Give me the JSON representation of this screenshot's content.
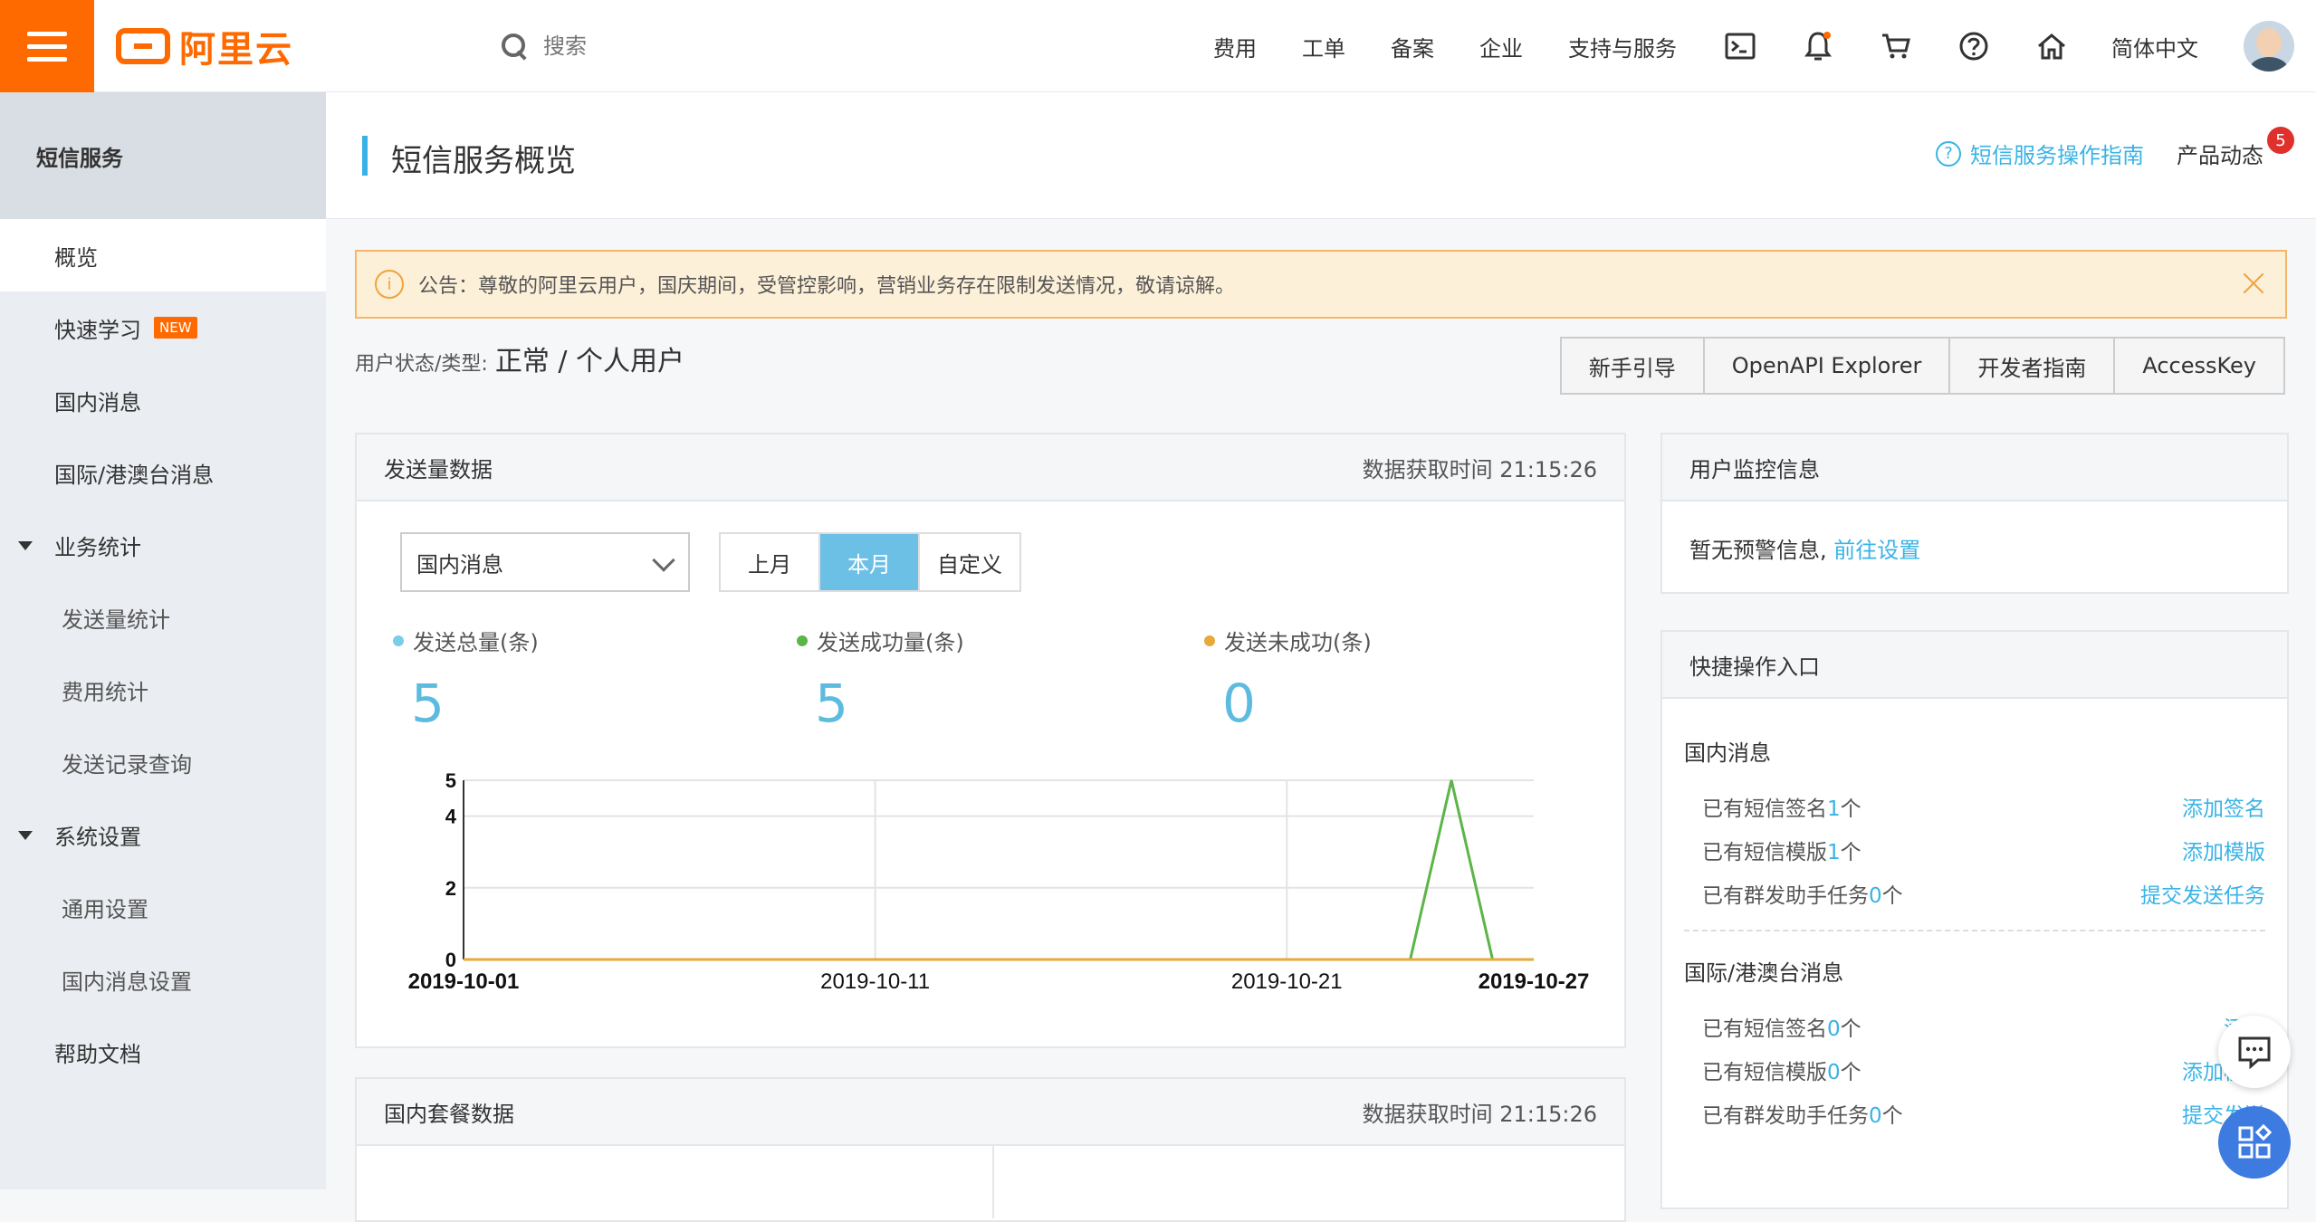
{
  "header": {
    "logo_text": "阿里云",
    "search_placeholder": "搜索",
    "nav": [
      "费用",
      "工单",
      "备案",
      "企业",
      "支持与服务"
    ],
    "language": "简体中文",
    "icons": [
      "terminal-icon",
      "bell-icon",
      "cart-icon",
      "help-icon",
      "home-icon"
    ]
  },
  "sidebar": {
    "title": "短信服务",
    "items": [
      {
        "label": "概览",
        "active": true
      },
      {
        "label": "快速学习",
        "badge": "NEW"
      },
      {
        "label": "国内消息"
      },
      {
        "label": "国际/港澳台消息"
      },
      {
        "label": "业务统计",
        "group": true
      },
      {
        "label": "发送量统计",
        "sub": true
      },
      {
        "label": "费用统计",
        "sub": true
      },
      {
        "label": "发送记录查询",
        "sub": true
      },
      {
        "label": "系统设置",
        "group": true
      },
      {
        "label": "通用设置",
        "sub": true
      },
      {
        "label": "国内消息设置",
        "sub": true
      },
      {
        "label": "帮助文档"
      }
    ]
  },
  "page": {
    "title": "短信服务概览",
    "guide_link": "短信服务操作指南",
    "product_news": "产品动态",
    "news_count": "5",
    "notice": "公告：尊敬的阿里云用户，国庆期间，受管控影响，营销业务存在限制发送情况，敬请谅解。",
    "user_status_label": "用户状态/类型:",
    "user_status_value": "正常 / 个人用户",
    "actions": [
      "新手引导",
      "OpenAPI Explorer",
      "开发者指南",
      "AccessKey"
    ]
  },
  "send_panel": {
    "title": "发送量数据",
    "time": "数据获取时间 21:15:26",
    "select_value": "国内消息",
    "range_buttons": [
      "上月",
      "本月",
      "自定义"
    ],
    "active_range": "本月",
    "stats": [
      {
        "label": "发送总量(条)",
        "value": "5",
        "color": "#7ccde9"
      },
      {
        "label": "发送成功量(条)",
        "value": "5",
        "color": "#5bb548"
      },
      {
        "label": "发送未成功(条)",
        "value": "0",
        "color": "#e6a93a"
      }
    ]
  },
  "chart_data": {
    "type": "line",
    "x_tick_labels": [
      "2019-10-01",
      "2019-10-11",
      "2019-10-21",
      "2019-10-27"
    ],
    "y_ticks": [
      0,
      2,
      4,
      5
    ],
    "ylim": [
      0,
      5
    ],
    "x": [
      "2019-10-01",
      "2019-10-02",
      "2019-10-03",
      "2019-10-04",
      "2019-10-05",
      "2019-10-06",
      "2019-10-07",
      "2019-10-08",
      "2019-10-09",
      "2019-10-10",
      "2019-10-11",
      "2019-10-12",
      "2019-10-13",
      "2019-10-14",
      "2019-10-15",
      "2019-10-16",
      "2019-10-17",
      "2019-10-18",
      "2019-10-19",
      "2019-10-20",
      "2019-10-21",
      "2019-10-22",
      "2019-10-23",
      "2019-10-24",
      "2019-10-25",
      "2019-10-26",
      "2019-10-27"
    ],
    "series": [
      {
        "name": "发送成功量(条)",
        "color": "#5bb548",
        "values": [
          0,
          0,
          0,
          0,
          0,
          0,
          0,
          0,
          0,
          0,
          0,
          0,
          0,
          0,
          0,
          0,
          0,
          0,
          0,
          0,
          0,
          0,
          0,
          0,
          5,
          0,
          0
        ]
      },
      {
        "name": "发送未成功(条)",
        "color": "#e6a93a",
        "values": [
          0,
          0,
          0,
          0,
          0,
          0,
          0,
          0,
          0,
          0,
          0,
          0,
          0,
          0,
          0,
          0,
          0,
          0,
          0,
          0,
          0,
          0,
          0,
          0,
          0,
          0,
          0
        ]
      }
    ],
    "grid": true
  },
  "monitor_panel": {
    "title": "用户监控信息",
    "text": "暂无预警信息,",
    "link": "前往设置"
  },
  "quick_panel": {
    "title": "快捷操作入口",
    "sections": [
      {
        "title": "国内消息",
        "rows": [
          {
            "prefix": "已有短信签名",
            "num": "1",
            "suffix": "个",
            "action": "添加签名"
          },
          {
            "prefix": "已有短信模版",
            "num": "1",
            "suffix": "个",
            "action": "添加模版"
          },
          {
            "prefix": "已有群发助手任务",
            "num": "0",
            "suffix": "个",
            "action": "提交发送任务"
          }
        ]
      },
      {
        "title": "国际/港澳台消息",
        "rows": [
          {
            "prefix": "已有短信签名",
            "num": "0",
            "suffix": "个",
            "action": "添加"
          },
          {
            "prefix": "已有短信模版",
            "num": "0",
            "suffix": "个",
            "action": "添加模版"
          },
          {
            "prefix": "已有群发助手任务",
            "num": "0",
            "suffix": "个",
            "action": "提交发送"
          }
        ]
      }
    ]
  },
  "pkg_panel": {
    "title": "国内套餐数据",
    "time": "数据获取时间 21:15:26"
  }
}
